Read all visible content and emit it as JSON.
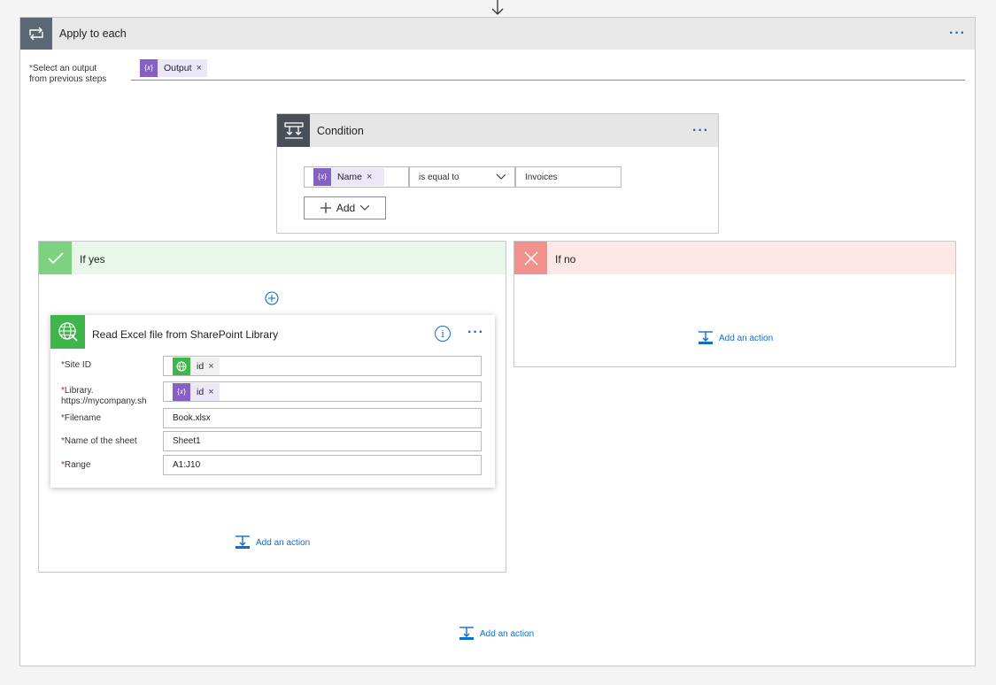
{
  "apply_to_each": {
    "title": "Apply to each",
    "select_label_line1": "Select an output",
    "select_label_line2": "from previous steps",
    "required_mark": "*",
    "token_label": "Output",
    "token_remove": "×",
    "more": "···"
  },
  "condition": {
    "title": "Condition",
    "more": "···",
    "left_token_label": "Name",
    "left_token_remove": "×",
    "operator": "is equal to",
    "value": "Invoices",
    "add_label": "Add"
  },
  "if_yes": {
    "title": "If yes",
    "add_action_label": "Add an action"
  },
  "if_no": {
    "title": "If no",
    "add_action_label": "Add an action"
  },
  "action_card": {
    "title": "Read Excel file from SharePoint Library",
    "info_glyph": "i",
    "more": "···",
    "fields": [
      {
        "label": "Site ID",
        "token": "id",
        "remove": "×"
      },
      {
        "label_line1": "Library.",
        "label_line2": "https://mycompany.sh",
        "token": "id",
        "remove": "×"
      },
      {
        "label": "Filename",
        "value": "Book.xlsx"
      },
      {
        "label": "Name of the sheet",
        "value": "Sheet1"
      },
      {
        "label": "Range",
        "value": "A1:J10"
      }
    ]
  },
  "bottom": {
    "add_action_label": "Add an action"
  },
  "token_icon_glyph": "{𝑥}",
  "colors": {
    "accent_blue": "#0f6fc6",
    "token_purple": "#8661c5",
    "token_bg": "#ebe7f8",
    "success_green": "#3fb64b",
    "yes_header": "#e9f6e9",
    "yes_icon": "#7fd182",
    "no_header": "#fde7e7",
    "no_icon": "#f1918d",
    "loop_icon": "#5b6775",
    "condition_icon": "#484f58"
  }
}
